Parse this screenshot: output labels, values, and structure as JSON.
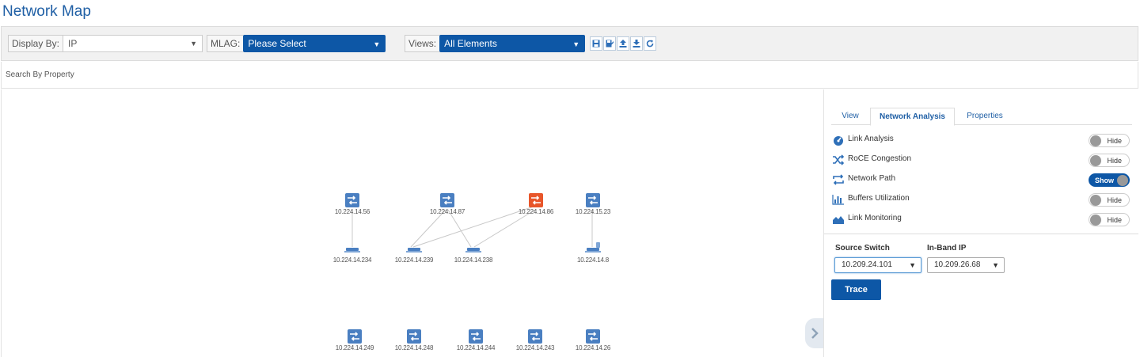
{
  "page_title": "Network Map",
  "toolbar": {
    "display_by_label": "Display By:",
    "display_by_value": "IP",
    "mlag_label": "MLAG:",
    "mlag_value": "Please Select",
    "views_label": "Views:",
    "views_value": "All Elements",
    "icons": [
      "save-icon",
      "save-as-icon",
      "upload-icon",
      "download-icon",
      "refresh-icon"
    ],
    "accent": "#0d57a6"
  },
  "search": {
    "label": "Search By Property"
  },
  "map": {
    "switch_color": "#4a7fc1",
    "alert_color": "#e8562a",
    "nodes": [
      {
        "id": "n1",
        "type": "switch",
        "label": "10.224.14.56"
      },
      {
        "id": "n2",
        "type": "switch",
        "label": "10.224.14.87"
      },
      {
        "id": "n3",
        "type": "switch-alert",
        "label": "10.224.14.86"
      },
      {
        "id": "n4",
        "type": "switch",
        "label": "10.224.15.23"
      },
      {
        "id": "n5",
        "type": "host",
        "label": "10.224.14.234"
      },
      {
        "id": "n6",
        "type": "host",
        "label": "10.224.14.239"
      },
      {
        "id": "n7",
        "type": "host",
        "label": "10.224.14.238"
      },
      {
        "id": "n8",
        "type": "host",
        "label": "10.224.14.8"
      },
      {
        "id": "n9",
        "type": "switch",
        "label": "10.224.14.249"
      },
      {
        "id": "n10",
        "type": "switch",
        "label": "10.224.14.248"
      },
      {
        "id": "n11",
        "type": "switch",
        "label": "10.224.14.244"
      },
      {
        "id": "n12",
        "type": "switch",
        "label": "10.224.14.243"
      },
      {
        "id": "n13",
        "type": "switch",
        "label": "10.224.14.26"
      }
    ]
  },
  "panel": {
    "tabs": [
      {
        "label": "View",
        "active": false
      },
      {
        "label": "Network Analysis",
        "active": true
      },
      {
        "label": "Properties",
        "active": false
      }
    ],
    "analysis_rows": [
      {
        "icon": "gauge-icon",
        "label": "Link Analysis",
        "toggle": "Hide",
        "on": false
      },
      {
        "icon": "shuffle-icon",
        "label": "RoCE Congestion",
        "toggle": "Hide",
        "on": false
      },
      {
        "icon": "path-icon",
        "label": "Network Path",
        "toggle": "Show",
        "on": true
      },
      {
        "icon": "bar-chart-icon",
        "label": "Buffers Utilization",
        "toggle": "Hide",
        "on": false
      },
      {
        "icon": "area-chart-icon",
        "label": "Link Monitoring",
        "toggle": "Hide",
        "on": false
      }
    ],
    "source_switch_label": "Source Switch",
    "source_switch_value": "10.209.24.101",
    "inband_ip_label": "In-Band IP",
    "inband_ip_value": "10.209.26.68",
    "trace_label": "Trace"
  }
}
